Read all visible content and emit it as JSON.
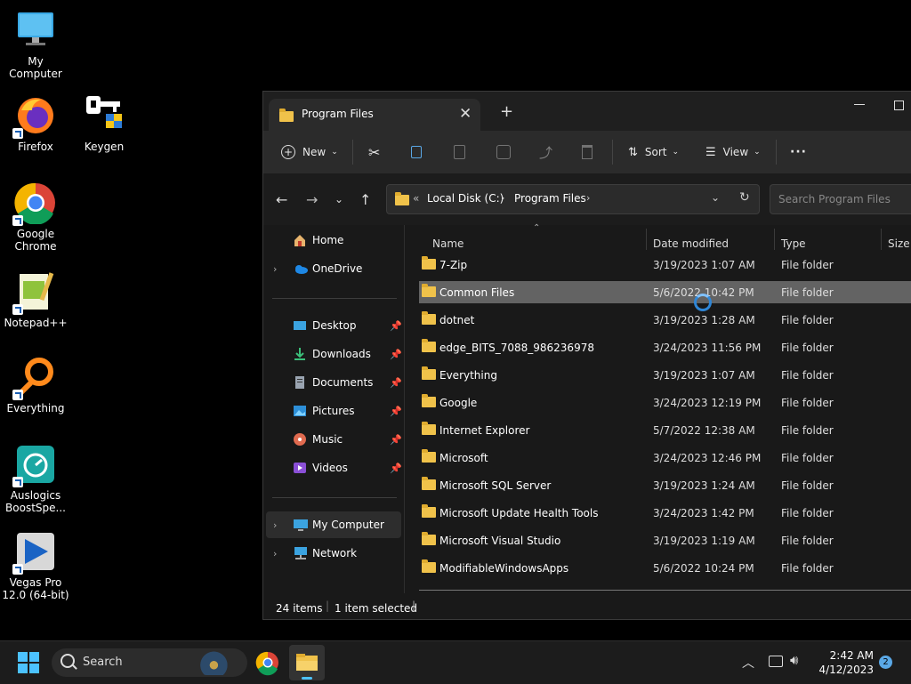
{
  "desktop": {
    "icons": [
      {
        "label": "My Computer",
        "icon": "monitor-icon"
      },
      {
        "label": "Firefox",
        "icon": "firefox-icon"
      },
      {
        "label": "Keygen",
        "icon": "keygen-icon"
      },
      {
        "label": "Google\nChrome",
        "icon": "chrome-icon"
      },
      {
        "label": "Notepad++",
        "icon": "notepad-plus-plus-icon"
      },
      {
        "label": "Everything",
        "icon": "everything-search-icon"
      },
      {
        "label": "Auslogics\nBoostSpe...",
        "icon": "auslogics-icon"
      },
      {
        "label": "Vegas Pro\n12.0 (64-bit)",
        "icon": "vegas-pro-icon"
      }
    ]
  },
  "window": {
    "tab_title": "Program Files",
    "toolbar": {
      "new_label": "New",
      "sort_label": "Sort",
      "view_label": "View",
      "more": "···"
    },
    "address": {
      "prefix": "«",
      "crumbs": [
        "Local Disk (C:)",
        "Program Files"
      ]
    },
    "search": {
      "placeholder": "Search Program Files"
    },
    "sidebar": {
      "home": "Home",
      "onedrive": "OneDrive",
      "quick": [
        {
          "label": "Desktop",
          "icon": "desktop-icon"
        },
        {
          "label": "Downloads",
          "icon": "download-icon"
        },
        {
          "label": "Documents",
          "icon": "documents-icon"
        },
        {
          "label": "Pictures",
          "icon": "pictures-icon"
        },
        {
          "label": "Music",
          "icon": "music-icon"
        },
        {
          "label": "Videos",
          "icon": "videos-icon"
        }
      ],
      "my_computer": "My Computer",
      "network": "Network"
    },
    "columns": {
      "name": "Name",
      "date": "Date modified",
      "type": "Type",
      "size": "Size"
    },
    "rows": [
      {
        "name": "7-Zip",
        "date": "3/19/2023 1:07 AM",
        "type": "File folder"
      },
      {
        "name": "Common Files",
        "date": "5/6/2022 10:42 PM",
        "type": "File folder",
        "selected": true
      },
      {
        "name": "dotnet",
        "date": "3/19/2023 1:28 AM",
        "type": "File folder"
      },
      {
        "name": "edge_BITS_7088_986236978",
        "date": "3/24/2023 11:56 PM",
        "type": "File folder"
      },
      {
        "name": "Everything",
        "date": "3/19/2023 1:07 AM",
        "type": "File folder"
      },
      {
        "name": "Google",
        "date": "3/24/2023 12:19 PM",
        "type": "File folder"
      },
      {
        "name": "Internet Explorer",
        "date": "5/7/2022 12:38 AM",
        "type": "File folder"
      },
      {
        "name": "Microsoft",
        "date": "3/24/2023 12:46 PM",
        "type": "File folder"
      },
      {
        "name": "Microsoft SQL Server",
        "date": "3/19/2023 1:24 AM",
        "type": "File folder"
      },
      {
        "name": "Microsoft Update Health Tools",
        "date": "3/24/2023 1:42 PM",
        "type": "File folder"
      },
      {
        "name": "Microsoft Visual Studio",
        "date": "3/19/2023 1:19 AM",
        "type": "File folder"
      },
      {
        "name": "ModifiableWindowsApps",
        "date": "5/6/2022 10:24 PM",
        "type": "File folder"
      }
    ],
    "status": {
      "items": "24 items",
      "selected": "1 item selected"
    }
  },
  "taskbar": {
    "search_label": "Search",
    "time": "2:42 AM",
    "date": "4/12/2023",
    "notifications": "2"
  },
  "colors": {
    "accent": "#0078d4",
    "folder": "#f0c24a",
    "selection": "#636363"
  }
}
